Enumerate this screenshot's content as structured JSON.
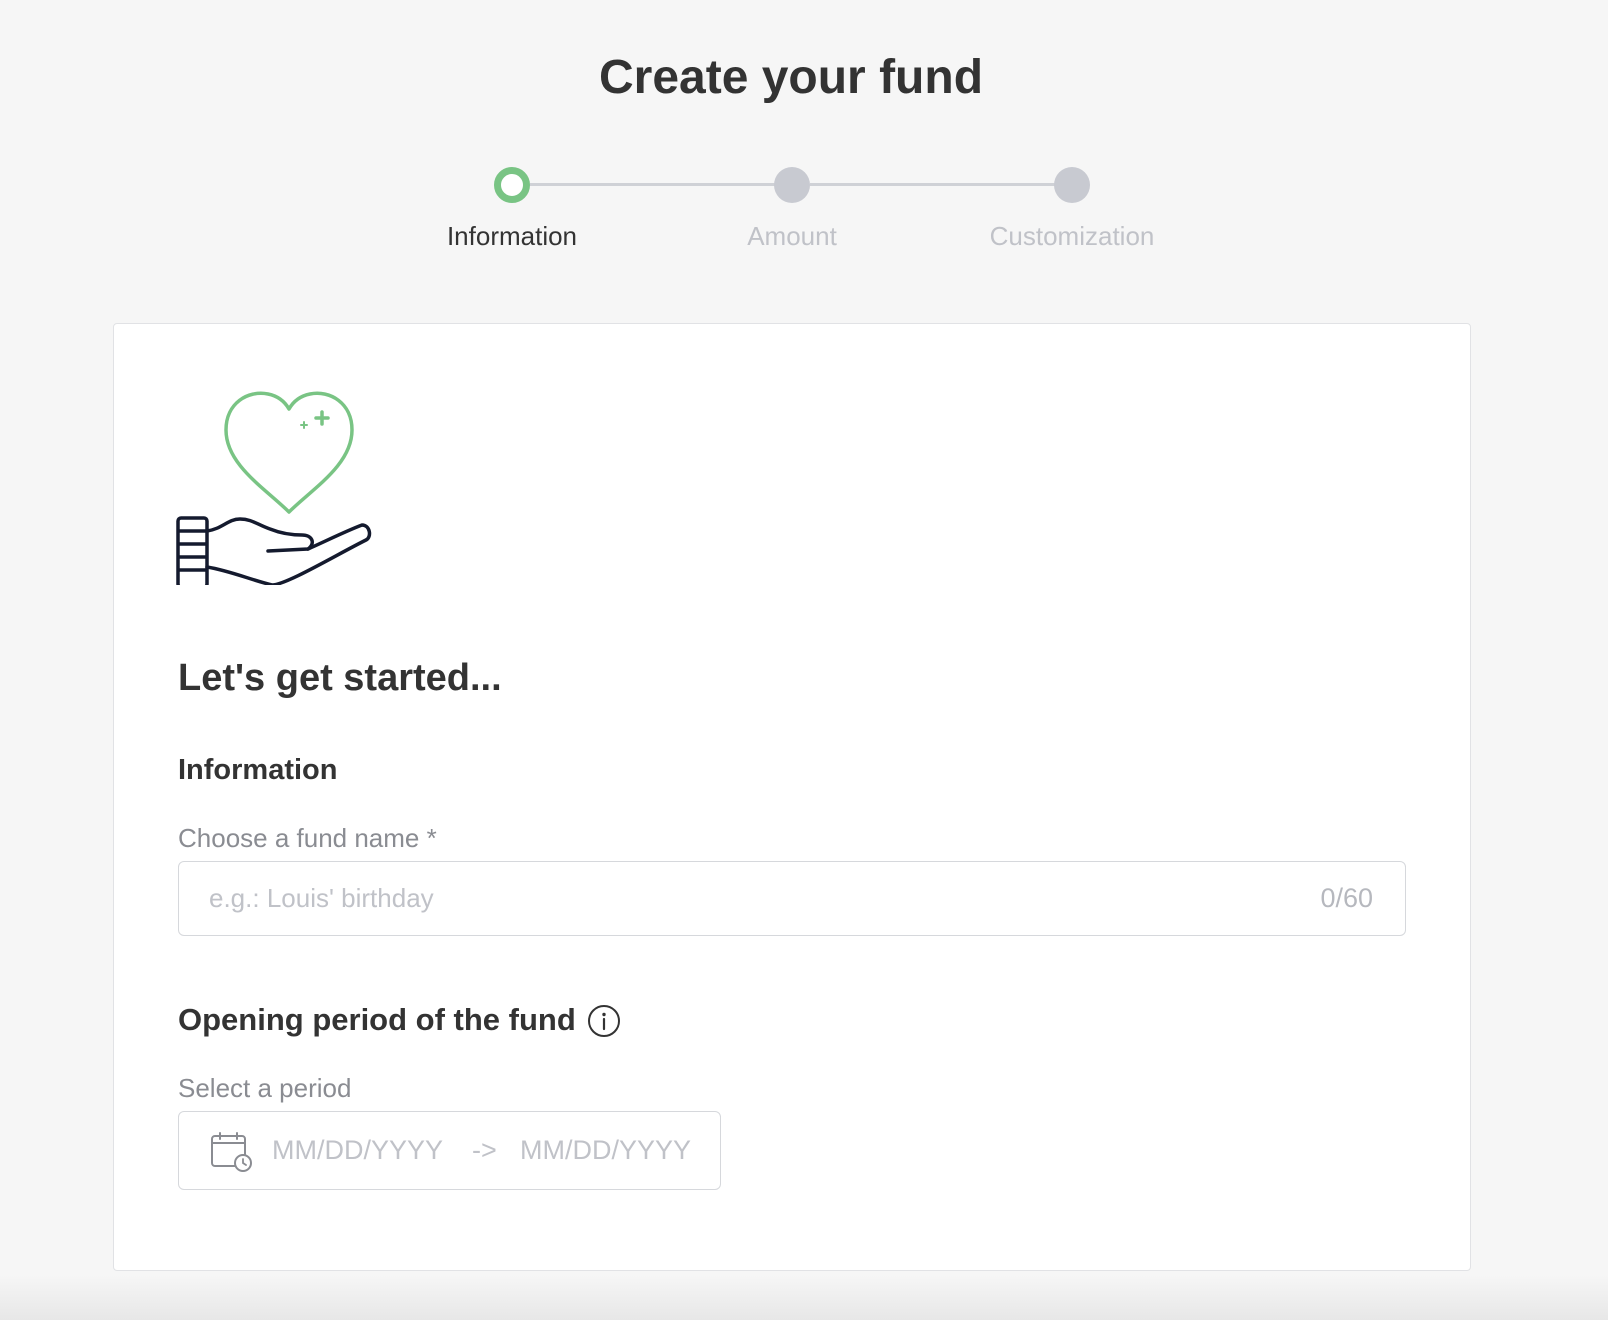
{
  "page": {
    "title": "Create your fund"
  },
  "stepper": {
    "steps": [
      {
        "label": "Information",
        "state": "active"
      },
      {
        "label": "Amount",
        "state": "inactive"
      },
      {
        "label": "Customization",
        "state": "inactive"
      }
    ],
    "active_color": "#79c484",
    "inactive_color": "#c8cad1"
  },
  "card": {
    "illustration": "hand-holding-heart-icon",
    "heading": "Let's get started...",
    "section_title": "Information",
    "fund_name": {
      "label": "Choose a fund name *",
      "placeholder": "e.g.: Louis' birthday",
      "value": "",
      "counter": "0/60"
    },
    "period": {
      "heading": "Opening period of the fund",
      "info_icon": "info-icon",
      "label": "Select a period",
      "calendar_icon": "calendar-clock-icon",
      "start_placeholder": "MM/DD/YYYY",
      "separator": "->",
      "end_placeholder": "MM/DD/YYYY"
    }
  }
}
